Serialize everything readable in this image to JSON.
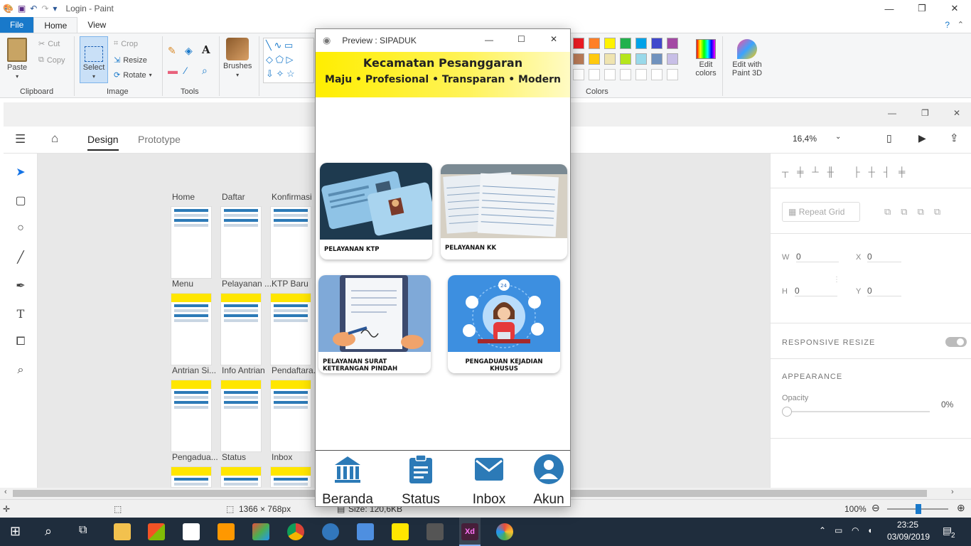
{
  "paint": {
    "window_title": "Login - Paint",
    "tabs": [
      "File",
      "Home",
      "View"
    ],
    "clipboard": {
      "paste": "Paste",
      "cut": "Cut",
      "copy": "Copy",
      "group": "Clipboard"
    },
    "image": {
      "select": "Select",
      "crop": "Crop",
      "resize": "Resize",
      "rotate": "Rotate",
      "group": "Image"
    },
    "tools_group": "Tools",
    "brushes": "Brushes",
    "colors_group": "Colors",
    "edit_colors": "Edit colors",
    "edit_paint3d": "Edit with Paint 3D",
    "status": {
      "dimensions": "1366 × 768px",
      "size": "Size: 120,6KB",
      "zoom": "100%"
    },
    "palette": [
      "#ed1c24",
      "#ff7f27",
      "#fff200",
      "#22b14c",
      "#00a2e8",
      "#3f48cc",
      "#a349a4",
      "#b97a57",
      "#ffc90e",
      "#efe4b0",
      "#b5e61d",
      "#99d9ea",
      "#7092be",
      "#c8bfe7"
    ]
  },
  "xd": {
    "tabs": {
      "design": "Design",
      "prototype": "Prototype"
    },
    "zoom": "16,4%",
    "artboards": [
      {
        "label": "Home"
      },
      {
        "label": "Daftar"
      },
      {
        "label": "Konfirmasi"
      },
      {
        "label": "Menu"
      },
      {
        "label": "Pelayanan ..."
      },
      {
        "label": "KTP Baru"
      },
      {
        "label": "Antrian Si..."
      },
      {
        "label": "Info Antrian"
      },
      {
        "label": "Pendaftara..."
      },
      {
        "label": "Pengadua..."
      },
      {
        "label": "Status"
      },
      {
        "label": "Inbox"
      }
    ],
    "right_panel": {
      "repeat_grid": "Repeat Grid",
      "w_label": "W",
      "w_value": "0",
      "x_label": "X",
      "x_value": "0",
      "h_label": "H",
      "h_value": "0",
      "y_label": "Y",
      "y_value": "0",
      "responsive_resize": "RESPONSIVE RESIZE",
      "appearance": "APPEARANCE",
      "opacity_label": "Opacity",
      "opacity_value": "0%"
    }
  },
  "preview": {
    "window_title": "Preview : SIPADUK",
    "header_title": "Kecamatan Pesanggaran",
    "header_subtitle": "Maju • Profesional • Transparan • Modern",
    "cards": [
      {
        "label": "PELAYANAN KTP"
      },
      {
        "label": "PELAYANAN KK"
      },
      {
        "label": "PELAYANAN SURAT KETERANGAN PINDAH"
      },
      {
        "label": "PENGADUAN KEJADIAN KHUSUS"
      }
    ],
    "nav": [
      {
        "label": "Beranda",
        "icon": "bank-icon"
      },
      {
        "label": "Status",
        "icon": "clipboard-icon"
      },
      {
        "label": "Inbox",
        "icon": "envelope-icon"
      },
      {
        "label": "Akun",
        "icon": "user-icon"
      }
    ]
  },
  "taskbar": {
    "time": "23:25",
    "date": "03/09/2019",
    "notifications": "2"
  }
}
